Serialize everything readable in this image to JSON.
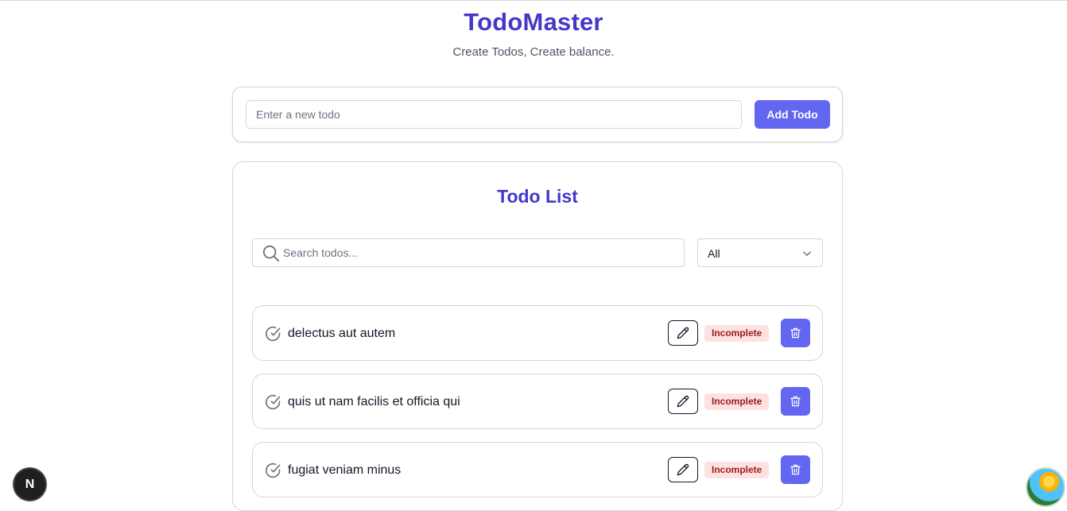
{
  "app": {
    "title": "TodoMaster",
    "subtitle": "Create Todos, Create balance."
  },
  "add_form": {
    "input_value": "",
    "input_placeholder": "Enter a new todo",
    "button_label": "Add Todo"
  },
  "list": {
    "title": "Todo List",
    "search_value": "",
    "search_placeholder": "Search todos...",
    "filter_selected": "All",
    "items": [
      {
        "text": "delectus aut autem",
        "status": "Incomplete"
      },
      {
        "text": "quis ut nam facilis et officia qui",
        "status": "Incomplete"
      },
      {
        "text": "fugiat veniam minus",
        "status": "Incomplete"
      }
    ]
  },
  "floating": {
    "dev_badge_label": "N"
  },
  "icons": {
    "search": "search-icon",
    "chevron": "chevron-down-icon",
    "check": "check-circle-icon",
    "edit": "pencil-icon",
    "delete": "trash-icon",
    "avatar": "avatar-image"
  },
  "colors": {
    "brand": "#4338ca",
    "button": "#6366f1",
    "badge_bg": "#fee2e2",
    "badge_text": "#991b1b"
  }
}
